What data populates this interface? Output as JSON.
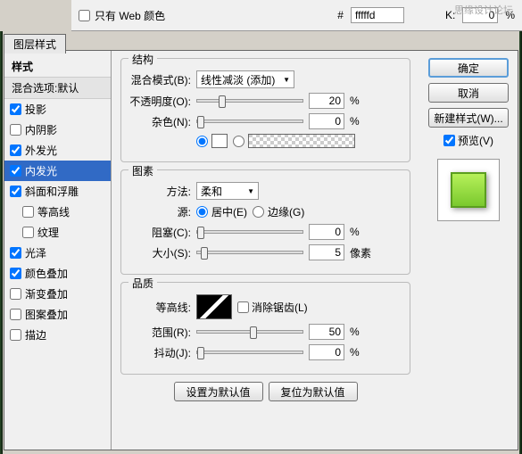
{
  "topbar": {
    "web_only": "只有 Web 颜色",
    "hash": "#",
    "hex": "fffffd",
    "k_label": "K:",
    "k_value": "0",
    "forum": "思缘设计论坛"
  },
  "tab": "图层样式",
  "left": {
    "header": "样式",
    "sub": "混合选项:默认",
    "items": [
      {
        "label": "投影",
        "checked": true
      },
      {
        "label": "内阴影",
        "checked": false
      },
      {
        "label": "外发光",
        "checked": true
      },
      {
        "label": "内发光",
        "checked": true,
        "selected": true
      },
      {
        "label": "斜面和浮雕",
        "checked": true
      },
      {
        "label": "等高线",
        "checked": false,
        "indent": true
      },
      {
        "label": "纹理",
        "checked": false,
        "indent": true
      },
      {
        "label": "光泽",
        "checked": true
      },
      {
        "label": "颜色叠加",
        "checked": true
      },
      {
        "label": "渐变叠加",
        "checked": false
      },
      {
        "label": "图案叠加",
        "checked": false
      },
      {
        "label": "描边",
        "checked": false
      }
    ]
  },
  "right": {
    "ok": "确定",
    "cancel": "取消",
    "new_style": "新建样式(W)...",
    "preview": "预览(V)"
  },
  "structure": {
    "title": "结构",
    "blend_mode_label": "混合模式(B):",
    "blend_mode": "线性减淡 (添加)",
    "opacity_label": "不透明度(O):",
    "opacity": "20",
    "pct": "%",
    "noise_label": "杂色(N):",
    "noise": "0"
  },
  "elements": {
    "title": "图素",
    "method_label": "方法:",
    "method": "柔和",
    "source_label": "源:",
    "center": "居中(E)",
    "edge": "边缘(G)",
    "choke_label": "阻塞(C):",
    "choke": "0",
    "size_label": "大小(S):",
    "size": "5",
    "px": "像素"
  },
  "quality": {
    "title": "品质",
    "contour_label": "等高线:",
    "anti_alias": "消除锯齿(L)",
    "range_label": "范围(R):",
    "range": "50",
    "jitter_label": "抖动(J):",
    "jitter": "0"
  },
  "bottom": {
    "set_default": "设置为默认值",
    "reset_default": "复位为默认值"
  },
  "pct": "%"
}
